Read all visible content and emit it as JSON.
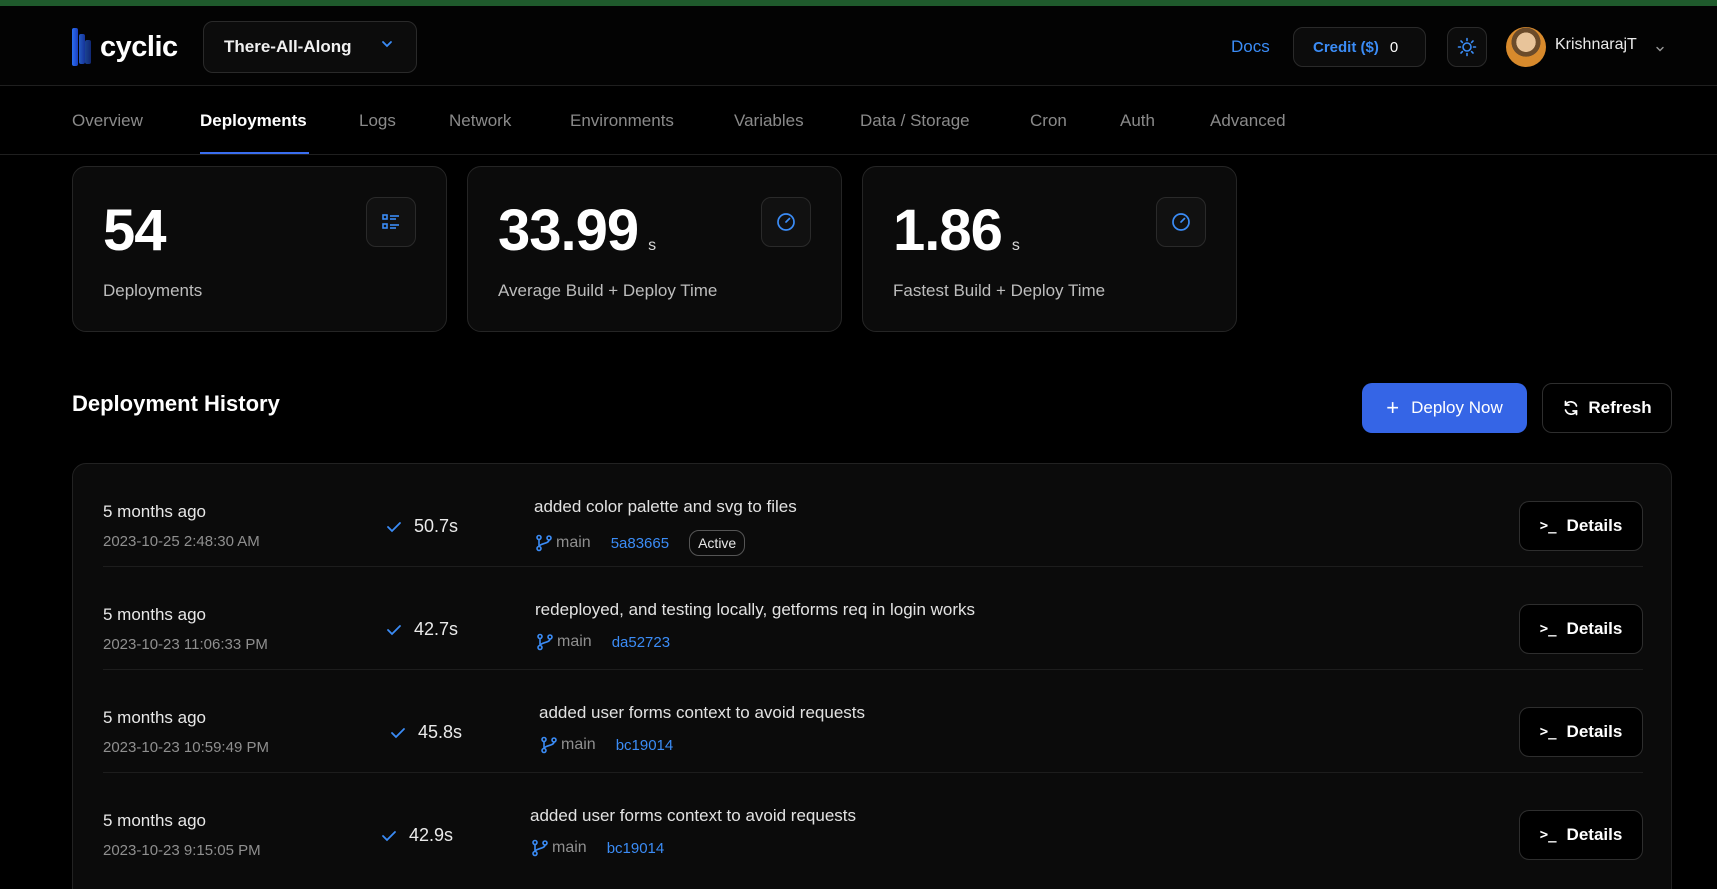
{
  "app": {
    "logo_text": "cyclic",
    "project": "There-All-Along",
    "docs": "Docs",
    "credit_label": "Credit ($)",
    "credit_value": "0",
    "username": "KrishnarajT"
  },
  "tabs": [
    {
      "label": "Overview"
    },
    {
      "label": "Deployments"
    },
    {
      "label": "Logs"
    },
    {
      "label": "Network"
    },
    {
      "label": "Environments"
    },
    {
      "label": "Variables"
    },
    {
      "label": "Data / Storage"
    },
    {
      "label": "Cron"
    },
    {
      "label": "Auth"
    },
    {
      "label": "Advanced"
    }
  ],
  "stats": [
    {
      "value": "54",
      "unit": "",
      "label": "Deployments",
      "icon": "list-icon"
    },
    {
      "value": "33.99",
      "unit": "s",
      "label": "Average Build + Deploy Time",
      "icon": "gauge-icon"
    },
    {
      "value": "1.86",
      "unit": "s",
      "label": "Fastest Build + Deploy Time",
      "icon": "gauge-icon"
    }
  ],
  "history": {
    "title": "Deployment History",
    "deploy_label": "Deploy Now",
    "refresh_label": "Refresh",
    "details_label": "Details",
    "rows": [
      {
        "ago": "5 months ago",
        "date": "2023-10-25 2:48:30 AM",
        "duration": "50.7s",
        "message": "added color palette and svg to files",
        "branch": "main",
        "sha": "5a83665",
        "badge": "Active"
      },
      {
        "ago": "5 months ago",
        "date": "2023-10-23 11:06:33 PM",
        "duration": "42.7s",
        "message": "redeployed, and testing locally, getforms req in login works",
        "branch": "main",
        "sha": "da52723",
        "badge": ""
      },
      {
        "ago": "5 months ago",
        "date": "2023-10-23 10:59:49 PM",
        "duration": "45.8s",
        "message": "added user forms context to avoid requests",
        "branch": "main",
        "sha": "bc19014",
        "badge": ""
      },
      {
        "ago": "5 months ago",
        "date": "2023-10-23 9:15:05 PM",
        "duration": "42.9s",
        "message": "added user forms context to avoid requests",
        "branch": "main",
        "sha": "bc19014",
        "badge": ""
      }
    ]
  },
  "colors": {
    "accent": "#3b8cf6",
    "primary_button": "#3565e6",
    "background": "#000000",
    "top_strip": "#1f5a2c"
  }
}
